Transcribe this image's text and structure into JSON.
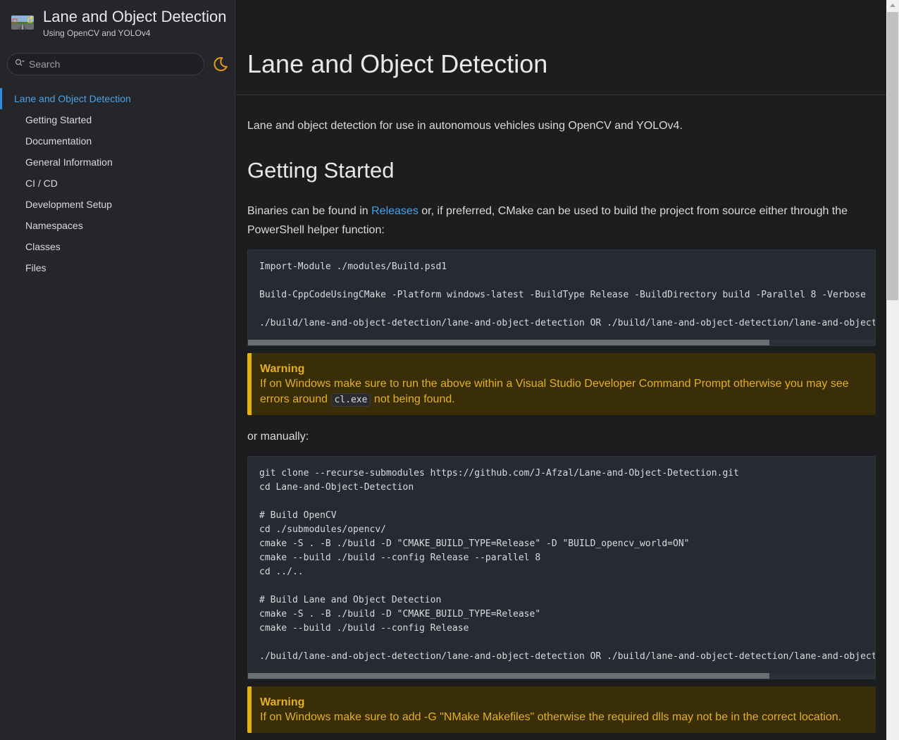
{
  "sidebar": {
    "project_name": "Lane and Object Detection",
    "project_brief": "Using OpenCV and YOLOv4",
    "search_placeholder": "Search",
    "nav": [
      {
        "label": "Lane and Object Detection"
      },
      {
        "label": "Getting Started"
      },
      {
        "label": "Documentation"
      },
      {
        "label": "General Information"
      },
      {
        "label": "CI / CD"
      },
      {
        "label": "Development Setup"
      },
      {
        "label": "Namespaces"
      },
      {
        "label": "Classes"
      },
      {
        "label": "Files"
      }
    ]
  },
  "main": {
    "title": "Lane and Object Detection",
    "intro": "Lane and object detection for use in autonomous vehicles using OpenCV and YOLOv4.",
    "getting_started": {
      "heading": "Getting Started",
      "binaries_prefix": "Binaries can be found in ",
      "releases_link": "Releases",
      "binaries_suffix": " or, if preferred, CMake can be used to build the project from source either through the PowerShell helper function:",
      "code1": "Import-Module ./modules/Build.psd1\n\nBuild-CppCodeUsingCMake -Platform windows-latest -BuildType Release -BuildDirectory build -Parallel 8 -Verbose\n\n./build/lane-and-object-detection/lane-and-object-detection OR ./build/lane-and-object-detection/lane-and-object-detection.exe",
      "warning1": {
        "title": "Warning",
        "text_before": "If on Windows make sure to run the above within a Visual Studio Developer Command Prompt otherwise you may see errors around ",
        "code": "cl.exe",
        "text_after": " not being found."
      },
      "or_manually": "or manually:",
      "code2": "git clone --recurse-submodules https://github.com/J-Afzal/Lane-and-Object-Detection.git\ncd Lane-and-Object-Detection\n\n# Build OpenCV\ncd ./submodules/opencv/\ncmake -S . -B ./build -D \"CMAKE_BUILD_TYPE=Release\" -D \"BUILD_opencv_world=ON\"\ncmake --build ./build --config Release --parallel 8\ncd ../..\n\n# Build Lane and Object Detection\ncmake -S . -B ./build -D \"CMAKE_BUILD_TYPE=Release\"\ncmake --build ./build --config Release\n\n./build/lane-and-object-detection/lane-and-object-detection OR ./build/lane-and-object-detection/lane-and-object-detection.exe",
      "warning2": {
        "title": "Warning",
        "text": "If on Windows make sure to add -G \"NMake Makefiles\" otherwise the required dlls may not be in the correct location."
      }
    }
  },
  "colors": {
    "accent": "#3ea3f0",
    "warning_border": "#e9b10c",
    "warning_bg": "#3a2e08",
    "theme_toggle": "#e99a0e"
  },
  "icons": {
    "search": "search-icon",
    "theme": "moon-icon",
    "logo": "project-logo"
  }
}
